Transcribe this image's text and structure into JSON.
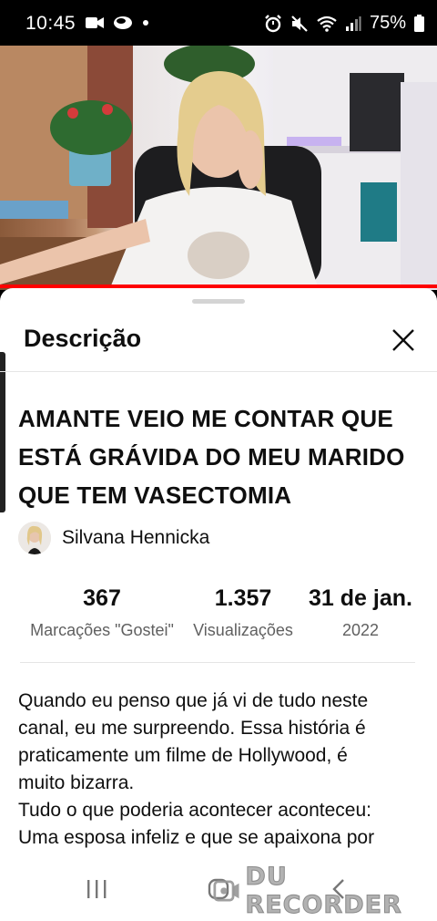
{
  "status_bar": {
    "time": "10:45",
    "battery": "75%"
  },
  "video": {
    "progress_fraction": 1.0,
    "progress_color": "#ff0000"
  },
  "sheet": {
    "title": "Descrição",
    "video_title": "AMANTE VEIO ME CONTAR QUE ESTÁ GRÁVIDA DO MEU MARIDO QUE TEM VASECTOMIA",
    "channel_name": "Silvana Hennicka",
    "stats": [
      {
        "value": "367",
        "label": "Marcações \"Gostei\""
      },
      {
        "value": "1.357",
        "label": "Visualizações"
      },
      {
        "value": "31 de jan.",
        "label": "2022"
      }
    ],
    "description_lines": [
      "Quando eu penso que já vi de tudo neste",
      "canal, eu me surpreendo. Essa história é",
      "praticamente um filme de Hollywood, é",
      "muito bizarra.",
      "Tudo o que poderia acontecer aconteceu:",
      "Uma esposa infeliz e que se apaixona por"
    ]
  },
  "watermark": "DU RECORDER",
  "icons": {
    "close": "close-icon",
    "recent_apps": "recent-apps-icon",
    "home": "home-icon",
    "back": "back-icon"
  }
}
